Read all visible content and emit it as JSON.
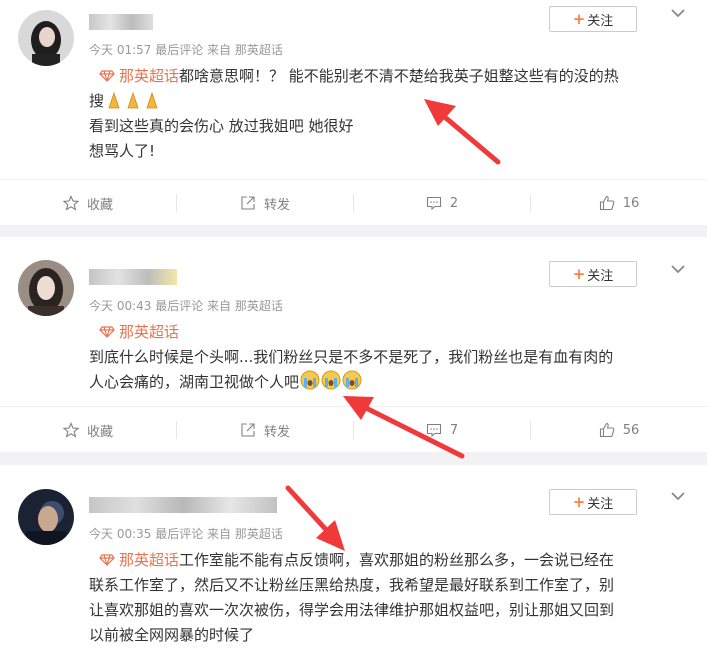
{
  "posts": [
    {
      "time": "今天 01:57",
      "source": "最后评论 来自 那英超话",
      "follow_label": "关注",
      "topic": "那英超话",
      "lines": [
        "都啥意思啊！？ 能不能别老不清不楚给我英子姐整这些有的没的热",
        "搜",
        "看到这些真的会伤心 放过我姐吧 她很好",
        "想骂人了!"
      ],
      "actions": {
        "collect": "收藏",
        "forward": "转发",
        "comments": "2",
        "likes": "16"
      }
    },
    {
      "time": "今天 00:43",
      "source": "最后评论 来自 那英超话",
      "follow_label": "关注",
      "topic": "那英超话",
      "lines": [
        "到底什么时候是个头啊...我们粉丝只是不多不是死了，我们粉丝也是有血有肉的",
        "人心会痛的，湖南卫视做个人吧"
      ],
      "actions": {
        "collect": "收藏",
        "forward": "转发",
        "comments": "7",
        "likes": "56"
      }
    },
    {
      "time": "今天 00:35",
      "source": "最后评论 来自 那英超话",
      "follow_label": "关注",
      "topic": "那英超话",
      "lines": [
        "工作室能不能有点反馈啊，喜欢那姐的粉丝那么多，一会说已经在",
        "联系工作室了，然后又不让粉丝压黑给热度，我希望是最好联系到工作室了，别",
        "让喜欢那姐的喜欢一次次被伤，得学会用法律维护那姐权益吧，别让那姐又回到",
        "以前被全网网暴的时候了"
      ]
    }
  ],
  "icons": {
    "star": "star-icon",
    "forward": "forward-icon",
    "comment": "comment-icon",
    "like": "like-icon",
    "topic": "diamond-icon",
    "more": "chevron-down-icon"
  },
  "colors": {
    "topic": "#eb7350",
    "follow_plus": "#ff8140",
    "arrow": "#f03a3a"
  }
}
